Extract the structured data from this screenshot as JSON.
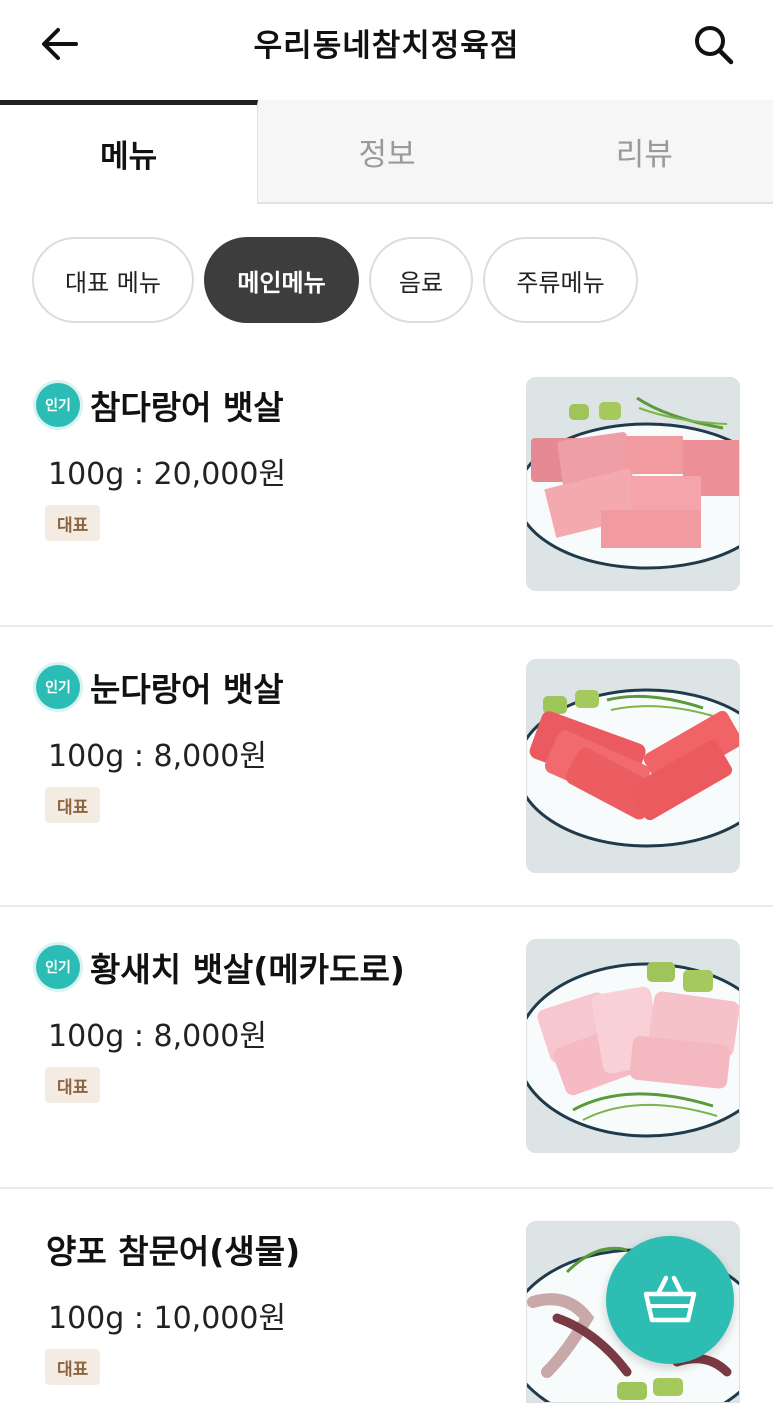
{
  "header": {
    "title": "우리동네참치정육점",
    "back_icon": "arrow-left-icon",
    "search_icon": "search-icon"
  },
  "tabs": [
    {
      "label": "메뉴",
      "active": true
    },
    {
      "label": "정보",
      "active": false
    },
    {
      "label": "리뷰",
      "active": false
    }
  ],
  "categories": [
    {
      "label": "대표 메뉴",
      "active": false
    },
    {
      "label": "메인메뉴",
      "active": true
    },
    {
      "label": "음료",
      "active": false
    },
    {
      "label": "주류메뉴",
      "active": false
    }
  ],
  "menu_items": [
    {
      "badge": "인기",
      "name": "참다랑어 뱃살",
      "price": "100g : 20,000원",
      "tag": "대표"
    },
    {
      "badge": "인기",
      "name": "눈다랑어 뱃살",
      "price": "100g : 8,000원",
      "tag": "대표"
    },
    {
      "badge": "인기",
      "name": "황새치 뱃살(메카도로)",
      "price": "100g : 8,000원",
      "tag": "대표"
    },
    {
      "badge": "",
      "name": "양포 참문어(생물)",
      "price": "100g : 10,000원",
      "tag": "대표"
    }
  ],
  "cart_button": {
    "icon": "basket-icon"
  },
  "colors": {
    "accent": "#2ebdb3",
    "chip_active": "#3d3d3d",
    "tag_bg": "#f4ece2",
    "tag_text": "#8c6440"
  }
}
